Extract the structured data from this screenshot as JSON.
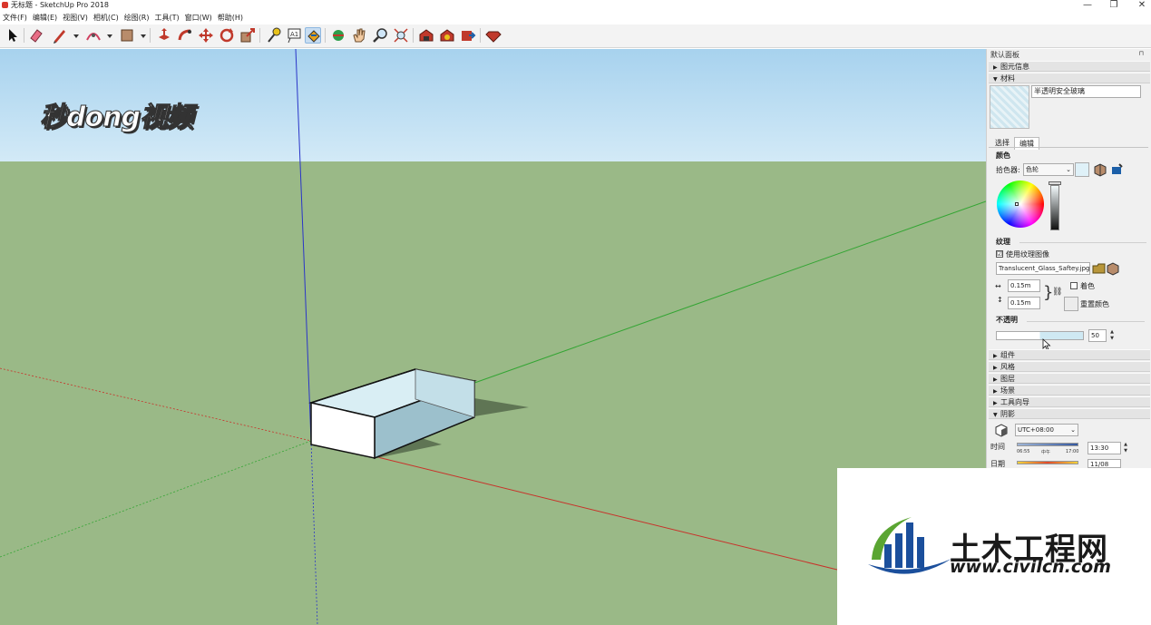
{
  "window": {
    "title": "无标题 - SketchUp Pro 2018",
    "minimize_glyph": "—",
    "maximize_glyph": "❐",
    "close_glyph": "✕"
  },
  "menu": [
    "文件(F)",
    "编辑(E)",
    "视图(V)",
    "相机(C)",
    "绘图(R)",
    "工具(T)",
    "窗口(W)",
    "帮助(H)"
  ],
  "watermark_tl": "秒dong视频",
  "panel": {
    "header": "默认面板",
    "pin": "⊓",
    "entity_info": "图元信息",
    "materials": "材料",
    "material_name": "半透明安全玻璃",
    "tabs": {
      "select": "选择",
      "edit": "编辑"
    },
    "color_heading": "颜色",
    "picker_label": "拾色器:",
    "picker_value": "色轮",
    "color_swatch": "#dff1f8",
    "texture_heading": "纹理",
    "use_texture": "使用纹理图像",
    "use_texture_checked": "☑",
    "texture_file": "Translucent_Glass_Saftey.jpg",
    "width": "0.15m",
    "height": "0.15m",
    "colorize": "着色",
    "reset_color": "重置颜色",
    "opacity_heading": "不透明",
    "opacity_value": "50",
    "opacity_percent": 50,
    "sections": [
      "组件",
      "风格",
      "图层",
      "场景",
      "工具向导",
      "阴影"
    ],
    "shadow": {
      "timezone": "UTC+08:00",
      "time_label": "时间",
      "time_start": "06:55",
      "time_mid": "中午",
      "time_end": "17:00",
      "time_value": "13:30",
      "date_label": "日期",
      "date_value": "11/08"
    }
  },
  "logo": {
    "name": "土木工程网",
    "url": "www.civilcn.com",
    "blue": "#1b4f9c",
    "green": "#5aa532"
  },
  "colors": {
    "sky_top": "#a7d2ee",
    "ground": "#9ab987",
    "axis_red": "#c8322a",
    "axis_green": "#34a534",
    "axis_blue": "#2a35c8",
    "glass": "#d3eaf2"
  }
}
